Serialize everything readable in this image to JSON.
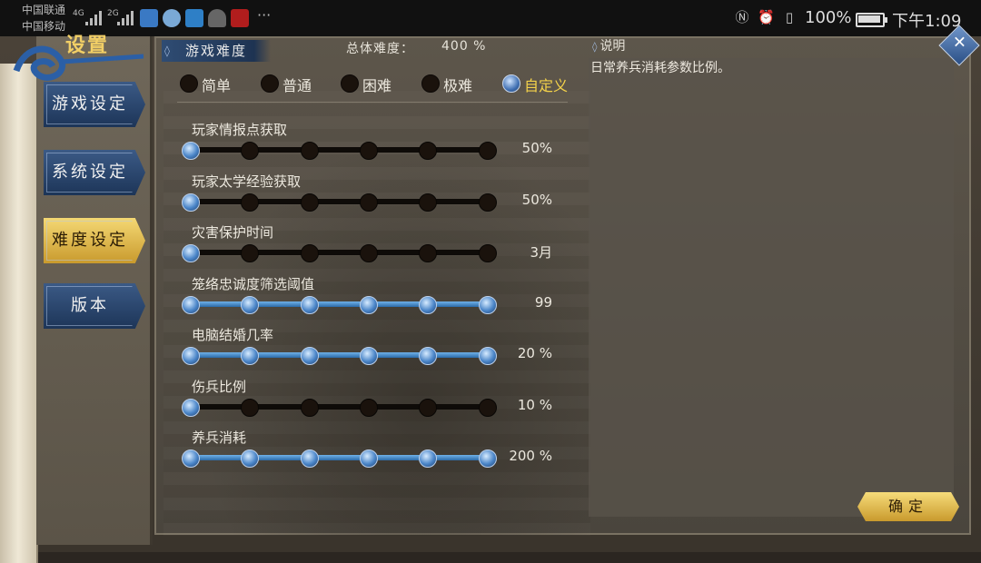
{
  "status_bar": {
    "carrier1": "中国联通",
    "carrier2": "中国移动",
    "net1": "4G",
    "net2": "2G",
    "more": "···",
    "battery_pct": "100%",
    "time": "下午1:09"
  },
  "window": {
    "title": "设置"
  },
  "sidebar": {
    "items": [
      {
        "label": "游戏设定",
        "active": false
      },
      {
        "label": "系统设定",
        "active": false
      },
      {
        "label": "难度设定",
        "active": true
      },
      {
        "label": "版本",
        "active": false
      }
    ]
  },
  "header": {
    "tab": "游戏难度",
    "total_label": "总体难度：",
    "total_value": "400 %"
  },
  "difficulty": {
    "options": [
      {
        "label": "简单",
        "selected": false
      },
      {
        "label": "普通",
        "selected": false
      },
      {
        "label": "困难",
        "selected": false
      },
      {
        "label": "极难",
        "selected": false
      },
      {
        "label": "自定义",
        "selected": true
      }
    ]
  },
  "settings": [
    {
      "label": "玩家情报点获取",
      "value": "50%",
      "level": 0
    },
    {
      "label": "玩家太学经验获取",
      "value": "50%",
      "level": 0
    },
    {
      "label": "灾害保护时间",
      "value": "3月",
      "level": 0
    },
    {
      "label": "笼络忠诚度筛选阈值",
      "value": "99",
      "level": 5
    },
    {
      "label": "电脑结婚几率",
      "value": "20 %",
      "level": 5
    },
    {
      "label": "伤兵比例",
      "value": "10 %",
      "level": 0
    },
    {
      "label": "养兵消耗",
      "value": "200 %",
      "level": 5
    }
  ],
  "description": {
    "title": "说明",
    "text": "日常养兵消耗参数比例。"
  },
  "buttons": {
    "ok": "确定",
    "close": "✕"
  },
  "colors": {
    "accent_gold": "#f4d24a",
    "slider_blue": "#4a85c8",
    "nav_blue": "#2a4a75"
  }
}
